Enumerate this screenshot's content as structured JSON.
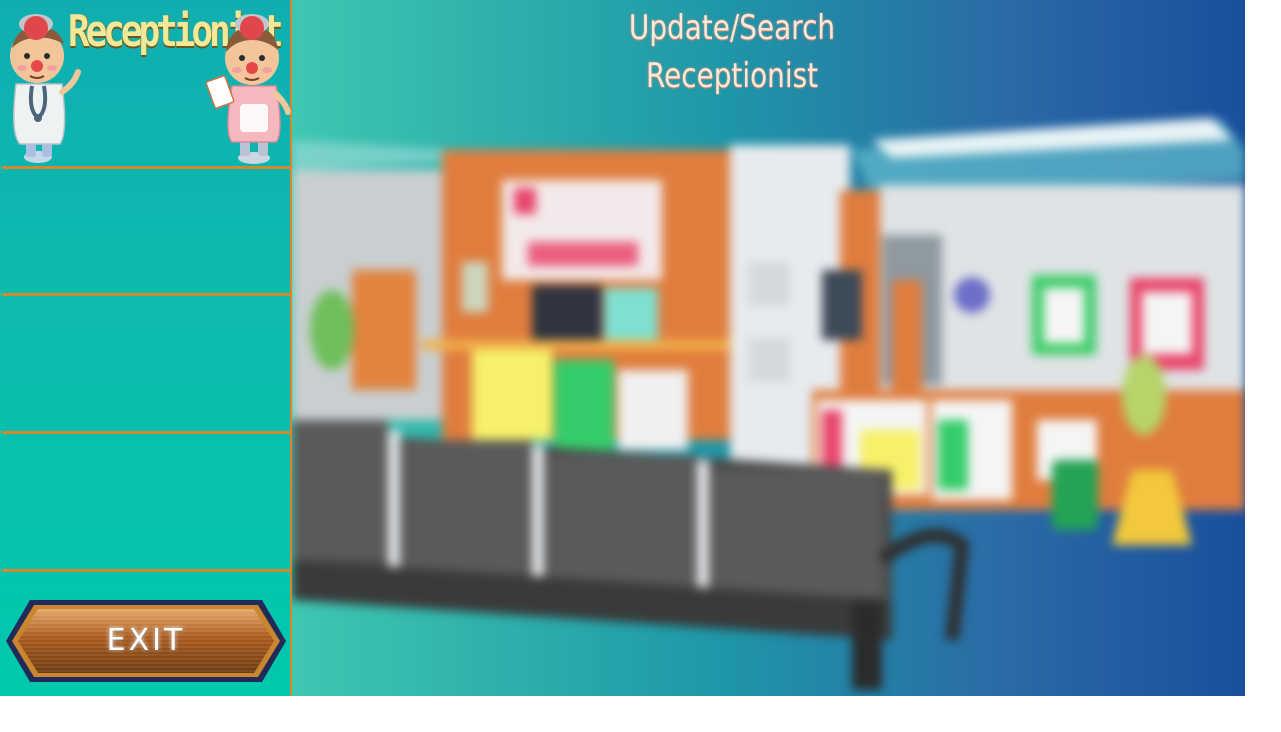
{
  "sidebar": {
    "logo_text": "Receptionist",
    "exit_label": "EXIT"
  },
  "main": {
    "title_line1": "Update/Search",
    "title_line2": "Receptionist"
  },
  "icons": {
    "doctor": "doctor-character-icon",
    "nurse": "nurse-character-icon"
  },
  "colors": {
    "sidebar_bg": "#0cb8ae",
    "divider": "#d38a2c",
    "logo_text": "#f2e89a",
    "title_text": "#f9e9d9",
    "scene_gradient_start": "#3fc7b0",
    "scene_gradient_end": "#1a4f9c"
  }
}
